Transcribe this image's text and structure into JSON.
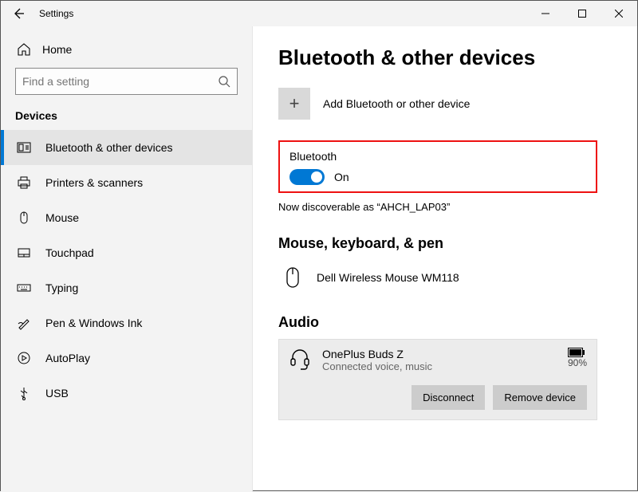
{
  "titlebar": {
    "title": "Settings"
  },
  "sidebar": {
    "home_label": "Home",
    "search_placeholder": "Find a setting",
    "section": "Devices",
    "items": [
      {
        "label": "Bluetooth & other devices"
      },
      {
        "label": "Printers & scanners"
      },
      {
        "label": "Mouse"
      },
      {
        "label": "Touchpad"
      },
      {
        "label": "Typing"
      },
      {
        "label": "Pen & Windows Ink"
      },
      {
        "label": "AutoPlay"
      },
      {
        "label": "USB"
      }
    ]
  },
  "main": {
    "title": "Bluetooth & other devices",
    "add_label": "Add Bluetooth or other device",
    "bluetooth_header": "Bluetooth",
    "toggle_state": "On",
    "discoverable": "Now discoverable as “AHCH_LAP03”",
    "group_mouse": "Mouse, keyboard, & pen",
    "mouse_device": "Dell Wireless Mouse WM118",
    "group_audio": "Audio",
    "audio_device": {
      "name": "OnePlus Buds Z",
      "status": "Connected voice, music",
      "battery": "90%"
    },
    "actions": {
      "disconnect": "Disconnect",
      "remove": "Remove device"
    }
  }
}
